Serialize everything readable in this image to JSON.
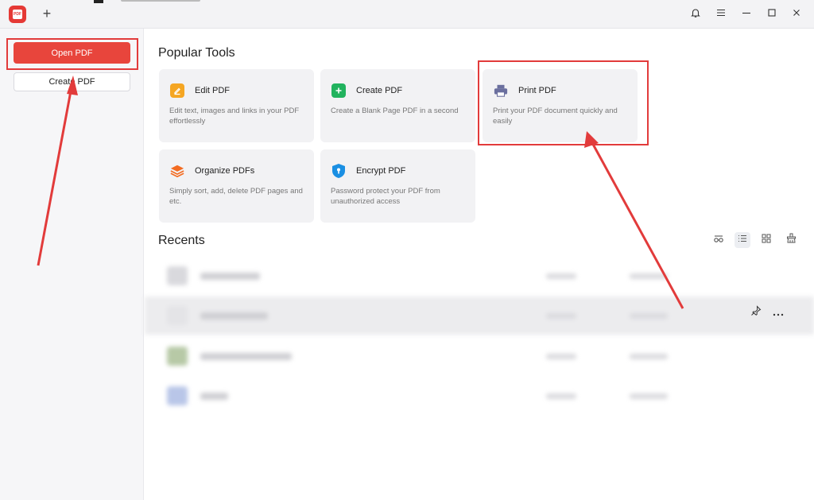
{
  "titlebar": {
    "logo_text": "PDF",
    "new_tab": "+",
    "icons": {
      "bell": "bell-icon",
      "menu": "menu-icon",
      "minimize": "minimize-icon",
      "maximize": "maximize-icon",
      "close": "close-icon"
    }
  },
  "sidebar": {
    "open_label": "Open PDF",
    "create_label": "Create PDF"
  },
  "popular_tools": {
    "title": "Popular Tools",
    "tools": [
      {
        "title": "Edit PDF",
        "desc": "Edit text, images and links in your PDF effortlessly",
        "icon": "edit-icon",
        "color": "#f5a623"
      },
      {
        "title": "Create PDF",
        "desc": "Create a Blank Page PDF in a second",
        "icon": "plus-icon",
        "color": "#22b35e"
      },
      {
        "title": "Print PDF",
        "desc": "Print your PDF document quickly and easily",
        "icon": "printer-icon",
        "color": "#6b6f9e"
      },
      {
        "title": "Organize PDFs",
        "desc": "Simply sort, add, delete PDF pages and etc.",
        "icon": "layers-icon",
        "color": "#f36b21"
      },
      {
        "title": "Encrypt PDF",
        "desc": "Password protect your PDF from unauthorized access",
        "icon": "shield-icon",
        "color": "#1a8fe3"
      }
    ]
  },
  "recents": {
    "title": "Recents"
  },
  "colors": {
    "accent": "#e8453c",
    "highlight": "#e23b3b"
  }
}
